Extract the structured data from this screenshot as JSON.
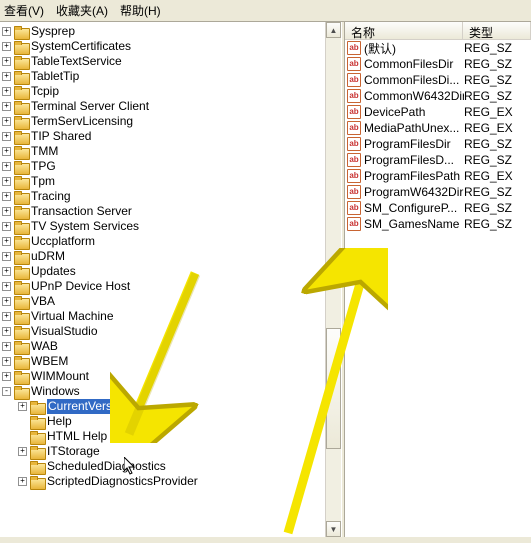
{
  "menu": {
    "view": "查看(V)",
    "favorites": "收藏夹(A)",
    "help": "帮助(H)"
  },
  "tree": {
    "indent0_plus": [
      {
        "label": "Sysprep"
      },
      {
        "label": "SystemCertificates"
      },
      {
        "label": "TableTextService"
      },
      {
        "label": "TabletTip"
      },
      {
        "label": "Tcpip"
      },
      {
        "label": "Terminal Server Client"
      },
      {
        "label": "TermServLicensing"
      },
      {
        "label": "TIP Shared"
      },
      {
        "label": "TMM"
      },
      {
        "label": "TPG"
      },
      {
        "label": "Tpm"
      },
      {
        "label": "Tracing"
      },
      {
        "label": "Transaction Server"
      },
      {
        "label": "TV System Services"
      },
      {
        "label": "Uccplatform"
      },
      {
        "label": "uDRM"
      },
      {
        "label": "Updates"
      },
      {
        "label": "UPnP Device Host"
      },
      {
        "label": "VBA"
      },
      {
        "label": "Virtual Machine"
      },
      {
        "label": "VisualStudio"
      },
      {
        "label": "WAB"
      },
      {
        "label": "WBEM"
      },
      {
        "label": "WIMMount"
      }
    ],
    "windows": "Windows",
    "windows_children": [
      {
        "label": "CurrentVersion",
        "selected": true,
        "expander": "+"
      },
      {
        "label": "Help"
      },
      {
        "label": "HTML Help"
      },
      {
        "label": "ITStorage",
        "expander": "+"
      },
      {
        "label": "ScheduledDiagnostics"
      },
      {
        "label": "ScriptedDiagnosticsProvider",
        "expander": "+"
      }
    ]
  },
  "columns": {
    "name": "名称",
    "type": "类型"
  },
  "values": [
    {
      "name": "(默认)",
      "type": "REG_SZ"
    },
    {
      "name": "CommonFilesDir",
      "type": "REG_SZ"
    },
    {
      "name": "CommonFilesDi...",
      "type": "REG_SZ"
    },
    {
      "name": "CommonW6432Dir",
      "type": "REG_SZ"
    },
    {
      "name": "DevicePath",
      "type": "REG_EX"
    },
    {
      "name": "MediaPathUnex...",
      "type": "REG_EX"
    },
    {
      "name": "ProgramFilesDir",
      "type": "REG_SZ"
    },
    {
      "name": "ProgramFilesD...",
      "type": "REG_SZ"
    },
    {
      "name": "ProgramFilesPath",
      "type": "REG_EX"
    },
    {
      "name": "ProgramW6432Dir",
      "type": "REG_SZ"
    },
    {
      "name": "SM_ConfigureP...",
      "type": "REG_SZ"
    },
    {
      "name": "SM_GamesName",
      "type": "REG_SZ"
    }
  ]
}
